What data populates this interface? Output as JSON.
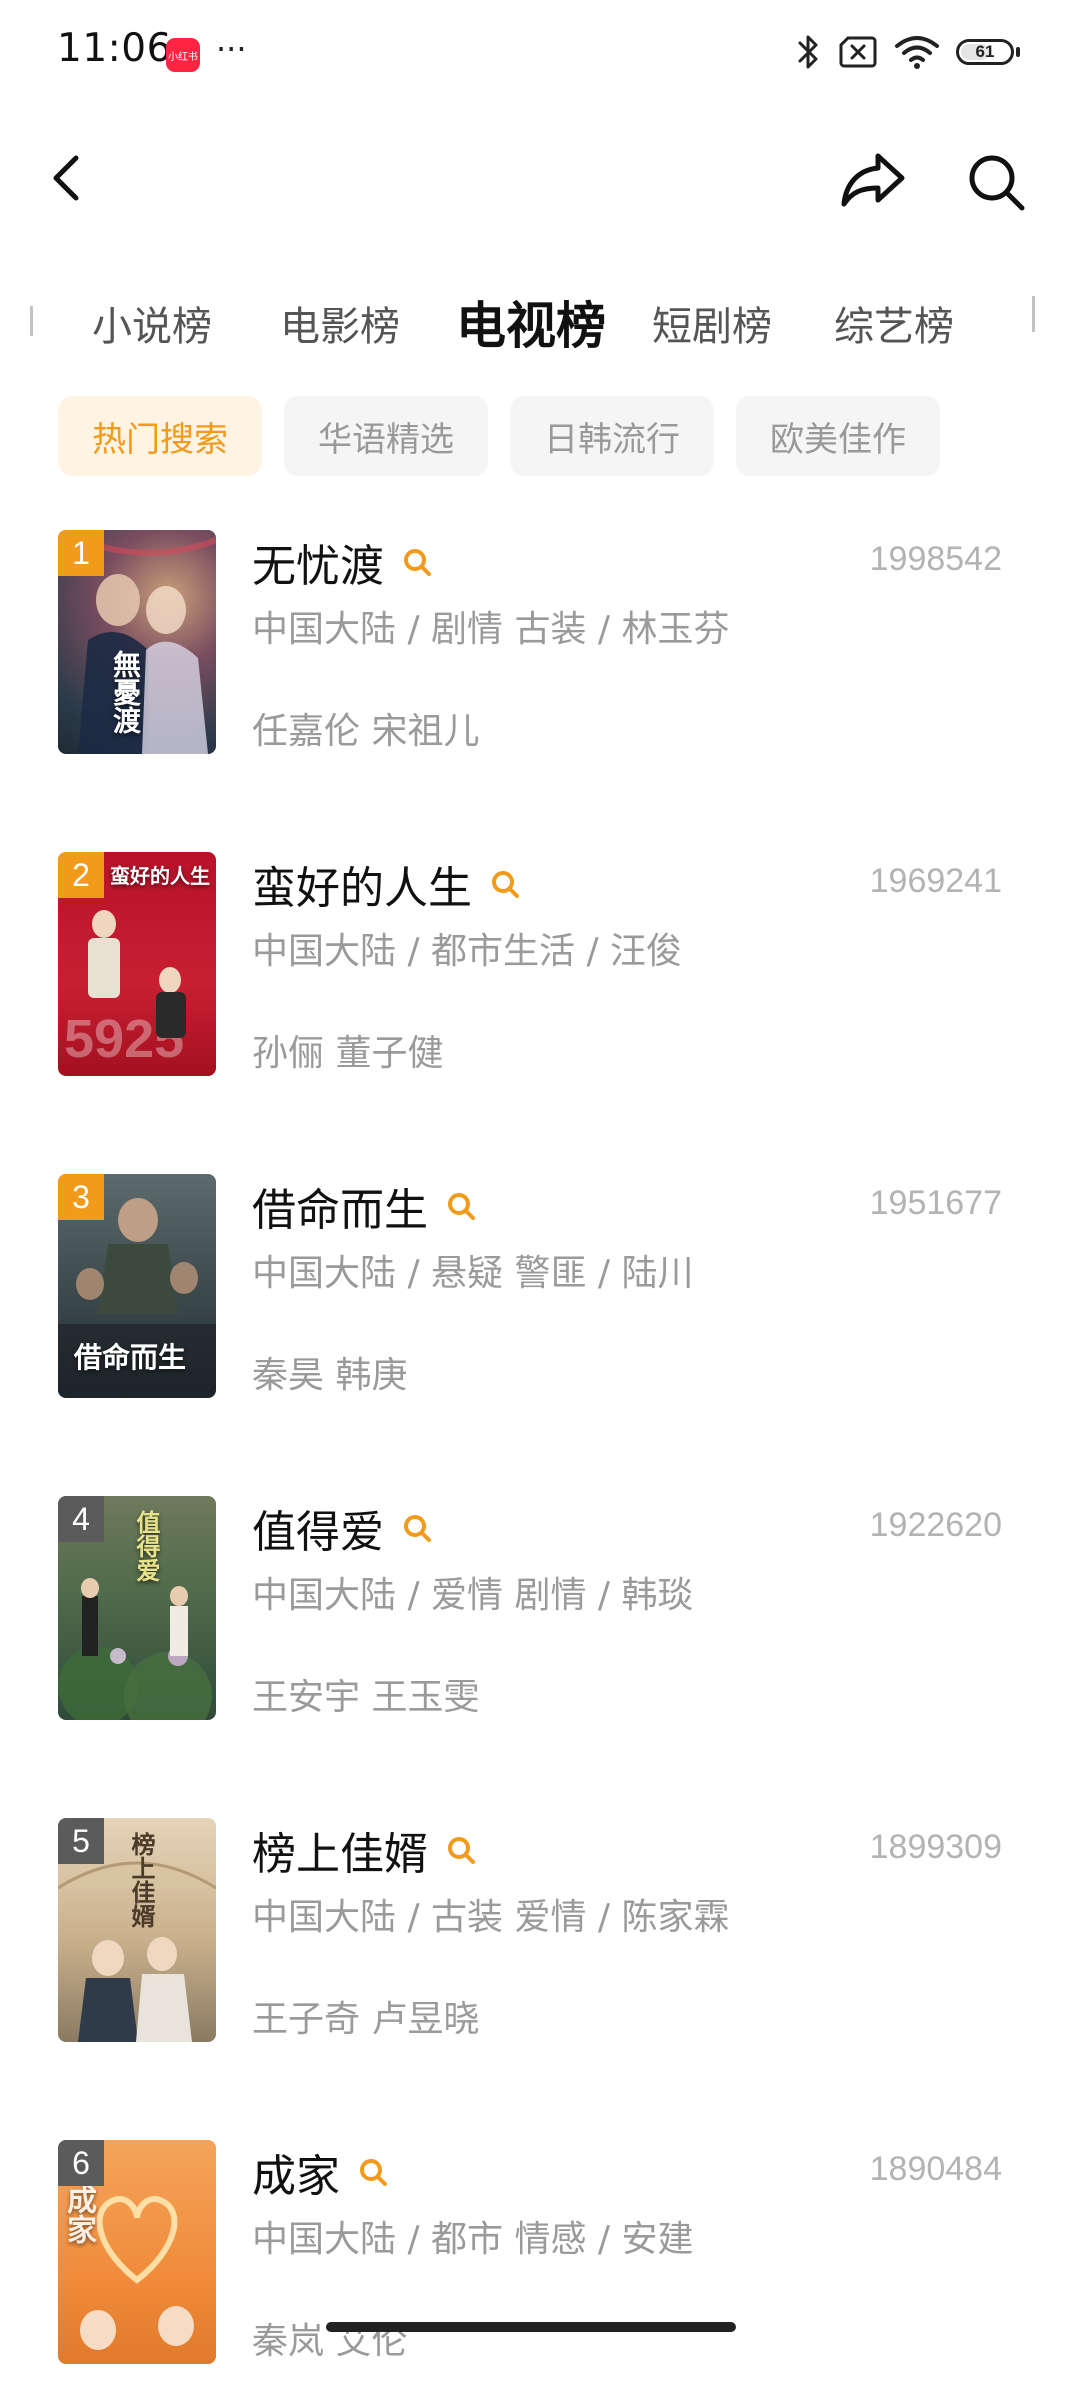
{
  "status_bar": {
    "time": "11:06",
    "app_icon_label": "小红书",
    "more": "···",
    "battery": "61",
    "battery_level": 0.61
  },
  "category_tabs": [
    {
      "label": "小说榜",
      "active": false
    },
    {
      "label": "电影榜",
      "active": false
    },
    {
      "label": "电视榜",
      "active": true
    },
    {
      "label": "短剧榜",
      "active": false
    },
    {
      "label": "综艺榜",
      "active": false
    }
  ],
  "filter_chips": [
    {
      "label": "热门搜索",
      "active": true
    },
    {
      "label": "华语精选",
      "active": false
    },
    {
      "label": "日韩流行",
      "active": false
    },
    {
      "label": "欧美佳作",
      "active": false
    }
  ],
  "list": [
    {
      "rank": "1",
      "title": "无忧渡",
      "count": "1998542",
      "meta": "中国大陆 / 剧情 古装 / 林玉芬",
      "cast": "任嘉伦 宋祖儿",
      "rank_color": "#f29a1a"
    },
    {
      "rank": "2",
      "title": "蛮好的人生",
      "count": "1969241",
      "meta": "中国大陆 / 都市生活 / 汪俊",
      "cast": "孙俪 董子健",
      "rank_color": "#f29a1a"
    },
    {
      "rank": "3",
      "title": "借命而生",
      "count": "1951677",
      "meta": "中国大陆 / 悬疑 警匪 / 陆川",
      "cast": "秦昊 韩庚",
      "rank_color": "#f29a1a"
    },
    {
      "rank": "4",
      "title": "值得爱",
      "count": "1922620",
      "meta": "中国大陆 / 爱情 剧情 / 韩琰",
      "cast": "王安宇 王玉雯",
      "rank_color": "#5b5b5b"
    },
    {
      "rank": "5",
      "title": "榜上佳婿",
      "count": "1899309",
      "meta": "中国大陆 / 古装 爱情 / 陈家霖",
      "cast": "王子奇 卢昱晓",
      "rank_color": "#5b5b5b"
    },
    {
      "rank": "6",
      "title": "成家",
      "count": "1890484",
      "meta": "中国大陆 / 都市 情感 / 安建",
      "cast": "秦岚 艾伦",
      "rank_color": "#5b5b5b"
    }
  ],
  "poster_texts": [
    "無憂渡",
    "蛮好的人生",
    "借命而生",
    "值得爱",
    "榜上佳婿",
    "成家"
  ],
  "colors": {
    "accent": "#f29a1a",
    "chip_active_bg": "#fff4e3",
    "muted_text": "#9a9a9a"
  }
}
